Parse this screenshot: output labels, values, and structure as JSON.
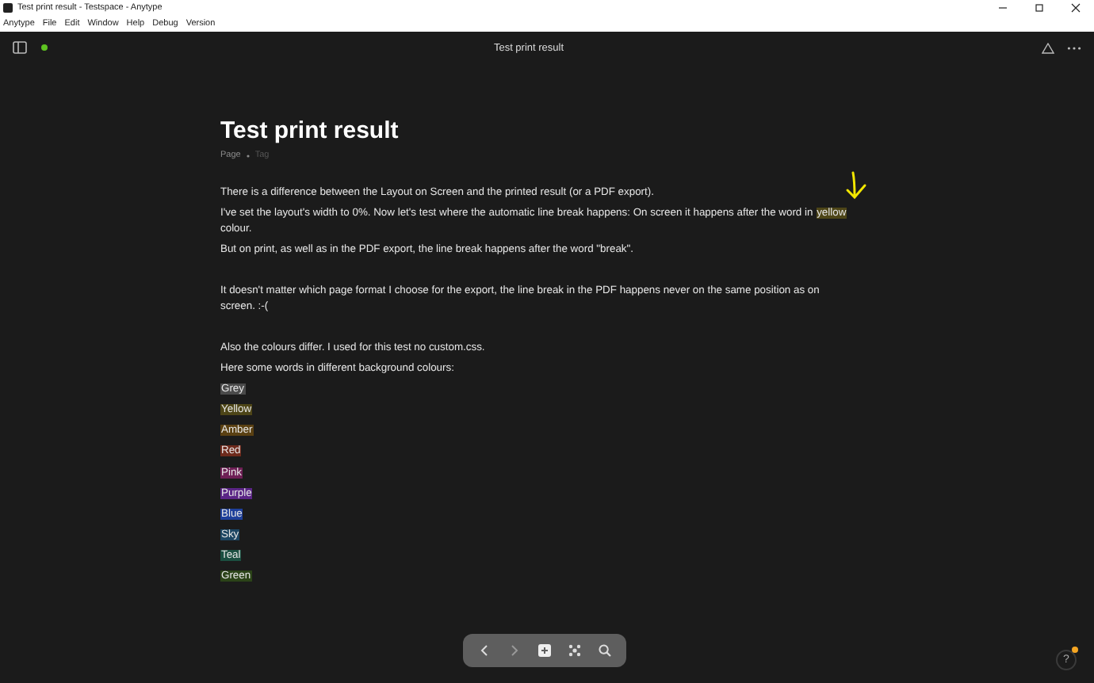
{
  "window": {
    "title": "Test print result - Testspace - Anytype"
  },
  "menu": [
    "Anytype",
    "File",
    "Edit",
    "Window",
    "Help",
    "Debug",
    "Version"
  ],
  "header": {
    "title": "Test print result"
  },
  "page": {
    "title": "Test print result",
    "type": "Page",
    "tag": "Tag",
    "blocks": [
      {
        "kind": "text",
        "parts": [
          {
            "text": "There is a difference between the Layout on Screen and the printed result (or a PDF export)."
          }
        ]
      },
      {
        "kind": "text",
        "parts": [
          {
            "text": "I've set the layout's width to 0%. Now let's test where the automatic line break happens: On screen it happens after the word in "
          },
          {
            "text": "yellow",
            "color": "#4d4517"
          },
          {
            "text": " colour."
          }
        ]
      },
      {
        "kind": "text",
        "parts": [
          {
            "text": "But on print, as well as in the PDF export, the line break happens after the word \"break\"."
          }
        ]
      },
      {
        "kind": "empty"
      },
      {
        "kind": "text",
        "parts": [
          {
            "text": "It doesn't matter which page format I choose for the export, the line break in the PDF happens never on the same position as on screen. :-("
          }
        ]
      },
      {
        "kind": "empty"
      },
      {
        "kind": "text",
        "parts": [
          {
            "text": "Also the colours differ. I used for this test no custom.css."
          }
        ]
      },
      {
        "kind": "text",
        "parts": [
          {
            "text": "Here some words in different background colours:"
          }
        ]
      },
      {
        "kind": "text",
        "parts": [
          {
            "text": "Grey",
            "color": "#4a4a4a"
          }
        ]
      },
      {
        "kind": "text",
        "parts": [
          {
            "text": "Yellow",
            "color": "#4d4517"
          }
        ]
      },
      {
        "kind": "text",
        "parts": [
          {
            "text": "Amber",
            "color": "#5a4012"
          }
        ]
      },
      {
        "kind": "text",
        "parts": [
          {
            "text": "Red",
            "color": "#6e2a1c"
          }
        ]
      },
      {
        "kind": "text",
        "parts": [
          {
            "text": "Pink",
            "color": "#6e1f55"
          }
        ]
      },
      {
        "kind": "text",
        "parts": [
          {
            "text": "Purple",
            "color": "#5b2586"
          }
        ]
      },
      {
        "kind": "text",
        "parts": [
          {
            "text": "Blue",
            "color": "#1e3f9a"
          }
        ]
      },
      {
        "kind": "text",
        "parts": [
          {
            "text": "Sky",
            "color": "#1d4663"
          }
        ]
      },
      {
        "kind": "text",
        "parts": [
          {
            "text": "Teal",
            "color": "#1b4f41"
          }
        ]
      },
      {
        "kind": "text",
        "parts": [
          {
            "text": "Green",
            "color": "#2b4318"
          }
        ]
      }
    ]
  },
  "help": {
    "label": "?"
  }
}
